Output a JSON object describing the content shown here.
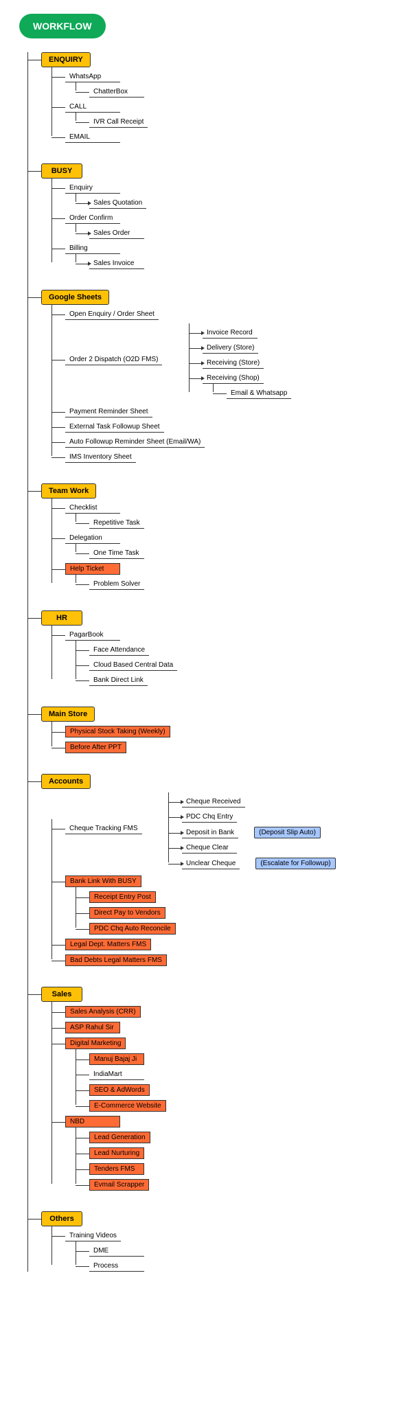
{
  "root": "WORKFLOW",
  "sections": {
    "enquiry": {
      "title": "ENQUIRY",
      "items": {
        "whatsapp": "WhatsApp",
        "chatterbox": "ChatterBox",
        "call": "CALL",
        "ivr": "IVR Call Receipt",
        "email": "EMAIL"
      }
    },
    "busy": {
      "title": "BUSY",
      "items": {
        "enq": "Enquiry",
        "sq": "Sales Quotation",
        "oc": "Order Confirm",
        "so": "Sales Order",
        "bill": "Billing",
        "si": "Sales Invoice"
      }
    },
    "gsheets": {
      "title": "Google Sheets",
      "items": {
        "open": "Open Enquiry / Order Sheet",
        "o2d": "Order 2 Dispatch (O2D FMS)",
        "inv": "Invoice Record",
        "del": "Delivery (Store)",
        "recst": "Receiving (Store)",
        "recsh": "Receiving (Shop)",
        "ewa": "Email & Whatsapp",
        "pay": "Payment Reminder Sheet",
        "ext": "External Task Followup Sheet",
        "auto": "Auto Followup Reminder Sheet (Email/WA)",
        "ims": "IMS Inventory Sheet"
      }
    },
    "team": {
      "title": "Team Work",
      "items": {
        "check": "Checklist",
        "rep": "Repetitive Task",
        "del": "Delegation",
        "one": "One Time Task",
        "help": "Help Ticket",
        "prob": "Problem Solver"
      }
    },
    "hr": {
      "title": "HR",
      "items": {
        "pagar": "PagarBook",
        "face": "Face Attendance",
        "cloud": "Cloud Based Central Data",
        "bank": "Bank Direct Link"
      }
    },
    "store": {
      "title": "Main Store",
      "items": {
        "phys": "Physical Stock Taking (Weekly)",
        "ba": "Before After PPT"
      }
    },
    "accounts": {
      "title": "Accounts",
      "items": {
        "ctfms": "Cheque Tracking FMS",
        "cr": "Cheque Received",
        "pdc": "PDC Chq Entry",
        "dib": "Deposit in Bank",
        "dsa": "(Deposit Slip Auto)",
        "cc": "Cheque Clear",
        "uc": "Unclear Cheque",
        "eff": "(Escalate for Followup)",
        "blb": "Bank Link With BUSY",
        "rep": "Receipt Entry Post",
        "dpv": "Direct Pay to Vendors",
        "par": "PDC Chq Auto Reconcile",
        "legal": "Legal Dept. Matters FMS",
        "bad": "Bad Debts Legal Matters FMS"
      }
    },
    "sales": {
      "title": "Sales",
      "items": {
        "sa": "Sales Analysis (CRR)",
        "asp": "ASP Rahul Sir",
        "dm": "Digital Marketing",
        "mb": "Manuj Bajaj Ji",
        "im": "IndiaMart",
        "seo": "SEO & AdWords",
        "ec": "E-Commerce Website",
        "nbd": "NBD",
        "lg": "Lead Generation",
        "ln": "Lead Nurturing",
        "tf": "Tenders FMS",
        "es": "Evmail Scrapper"
      }
    },
    "others": {
      "title": "Others",
      "items": {
        "tv": "Training Videos",
        "dme": "DME",
        "proc": "Process"
      }
    }
  }
}
